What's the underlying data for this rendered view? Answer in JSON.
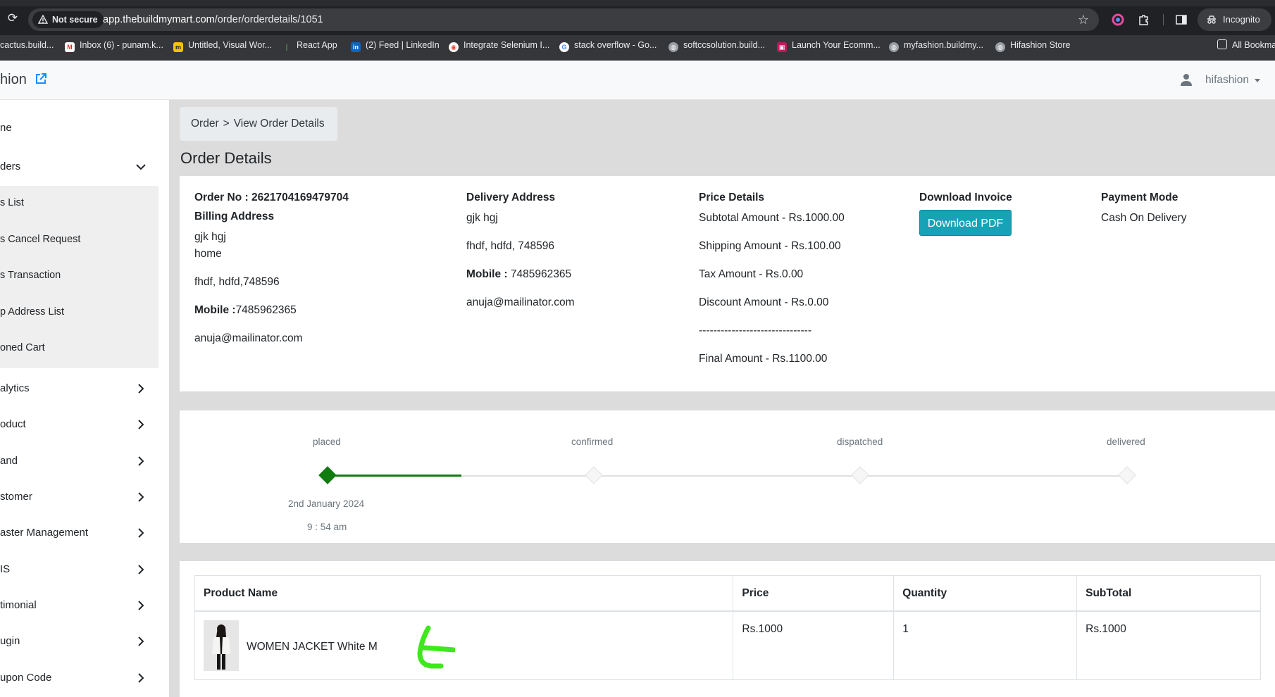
{
  "browser": {
    "security_label": "Not secure",
    "url_host": "app.thebuildmymart.com",
    "url_path": "/order/orderdetails/1051",
    "incognito_label": "Incognito",
    "bookmarks": [
      "cactus.build...",
      "Inbox (6) - punam.k...",
      "Untitled, Visual Wor...",
      "React App",
      "(2) Feed | LinkedIn",
      "Integrate Selenium I...",
      "stack overflow - Go...",
      "softccsolution.build...",
      "Launch Your Ecomm...",
      "myfashion.buildmy...",
      "Hifashion Store"
    ],
    "all_bookmarks": "All Bookma"
  },
  "header": {
    "brand": "hion",
    "user": "hifashion"
  },
  "sidebar": {
    "items": [
      {
        "label": "ne"
      },
      {
        "label": "ders"
      },
      {
        "label": "alytics"
      },
      {
        "label": "oduct"
      },
      {
        "label": "and"
      },
      {
        "label": "stomer"
      },
      {
        "label": "aster Management"
      },
      {
        "label": "IS"
      },
      {
        "label": "timonial"
      },
      {
        "label": "ugin"
      },
      {
        "label": "upon Code"
      }
    ],
    "sub_items": [
      {
        "label": "s List"
      },
      {
        "label": "s Cancel Request"
      },
      {
        "label": "s Transaction"
      },
      {
        "label": "p Address List"
      },
      {
        "label": "oned Cart"
      }
    ]
  },
  "breadcrumb": {
    "root": "Order",
    "separator": ">",
    "current": "View Order Details"
  },
  "page_title": "Order Details",
  "order": {
    "order_no_label": "Order No :",
    "order_no": "2621704169479704",
    "billing_title": "Billing Address",
    "billing_name": "gjk hgj",
    "billing_type": "home",
    "billing_addr": "fhdf, hdfd,748596",
    "mobile_label": "Mobile :",
    "billing_mobile": "7485962365",
    "billing_email": "anuja@mailinator.com",
    "delivery_title": "Delivery Address",
    "delivery_name": "gjk hgj",
    "delivery_addr": "fhdf, hdfd, 748596",
    "delivery_mobile": "7485962365",
    "delivery_email": "anuja@mailinator.com",
    "price_title": "Price Details",
    "subtotal": "Subtotal Amount - Rs.1000.00",
    "shipping": "Shipping Amount - Rs.100.00",
    "tax": "Tax Amount - Rs.0.00",
    "discount": "Discount Amount - Rs.0.00",
    "divider": "-------------------------------",
    "final": "Final Amount - Rs.1100.00",
    "invoice_title": "Download Invoice",
    "download_btn": "Download PDF",
    "payment_title": "Payment Mode",
    "payment_mode": "Cash On Delivery"
  },
  "tracker": {
    "steps": [
      {
        "label": "placed",
        "done": true
      },
      {
        "label": "confirmed",
        "done": false
      },
      {
        "label": "dispatched",
        "done": false
      },
      {
        "label": "delivered",
        "done": false
      }
    ],
    "placed_date": "2nd January 2024",
    "placed_time": "9 : 54 am",
    "done_color": "#107c10"
  },
  "table": {
    "headers": [
      "Product Name",
      "Price",
      "Quantity",
      "SubTotal"
    ],
    "rows": [
      {
        "name": "WOMEN JACKET White M",
        "price": "Rs.1000",
        "quantity": "1",
        "subtotal": "Rs.1000"
      }
    ]
  },
  "colors": {
    "accent": "#17a2b8",
    "annotation": "#3fe81c"
  }
}
